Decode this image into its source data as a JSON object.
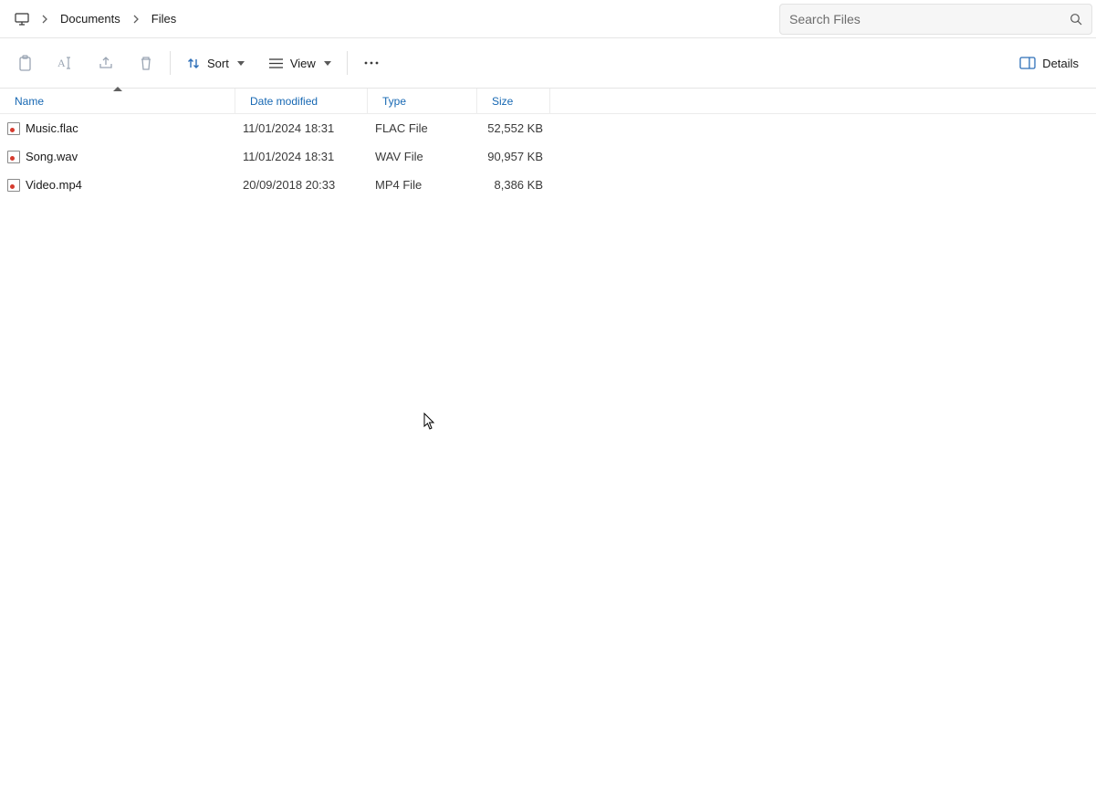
{
  "breadcrumb": {
    "segments": [
      "Documents",
      "Files"
    ]
  },
  "search": {
    "placeholder": "Search Files"
  },
  "toolbar": {
    "sort_label": "Sort",
    "view_label": "View",
    "details_label": "Details"
  },
  "columns": {
    "name": "Name",
    "date": "Date modified",
    "type": "Type",
    "size": "Size"
  },
  "files": [
    {
      "name": "Music.flac",
      "date": "11/01/2024 18:31",
      "type": "FLAC File",
      "size": "52,552 KB"
    },
    {
      "name": "Song.wav",
      "date": "11/01/2024 18:31",
      "type": "WAV File",
      "size": "90,957 KB"
    },
    {
      "name": "Video.mp4",
      "date": "20/09/2018 20:33",
      "type": "MP4 File",
      "size": "8,386 KB"
    }
  ]
}
